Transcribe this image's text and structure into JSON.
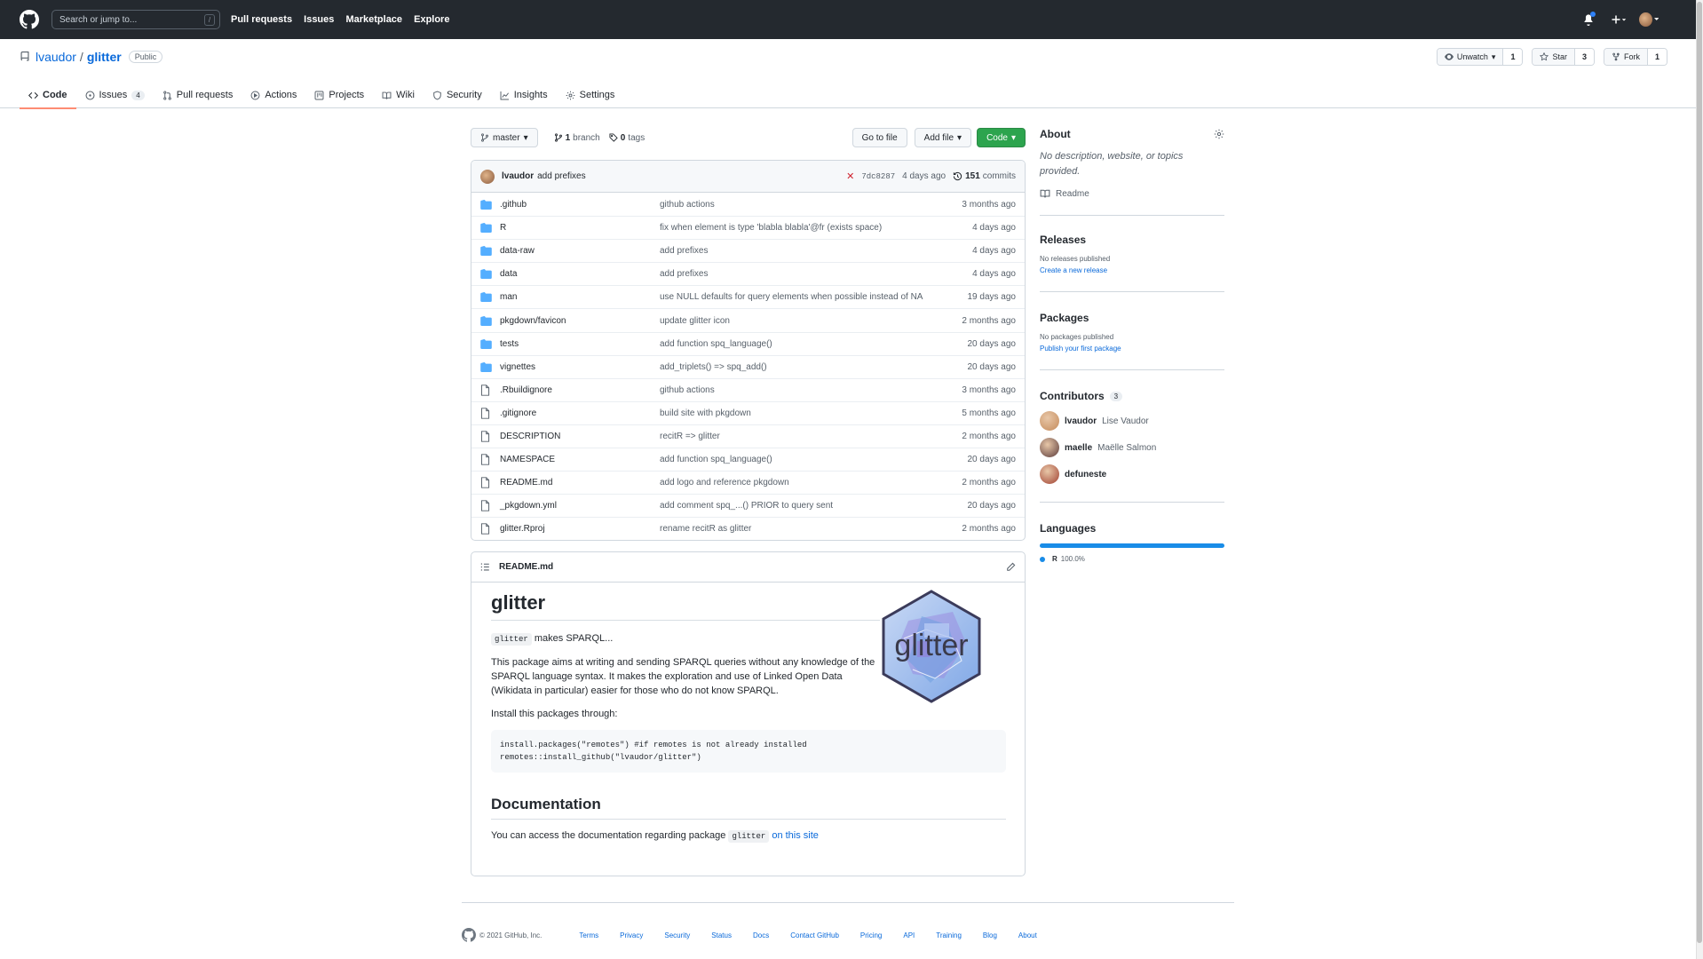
{
  "header": {
    "search_placeholder": "Search or jump to...",
    "search_key": "/",
    "nav": [
      "Pull requests",
      "Issues",
      "Marketplace",
      "Explore"
    ]
  },
  "repo": {
    "owner": "lvaudor",
    "name": "glitter",
    "visibility": "Public",
    "unwatch_label": "Unwatch",
    "watch_count": "1",
    "star_label": "Star",
    "star_count": "3",
    "fork_label": "Fork",
    "fork_count": "1"
  },
  "tabs": [
    {
      "label": "Code",
      "icon": "code-icon"
    },
    {
      "label": "Issues",
      "count": "4",
      "icon": "issue-icon"
    },
    {
      "label": "Pull requests",
      "icon": "pull-request-icon"
    },
    {
      "label": "Actions",
      "icon": "play-icon"
    },
    {
      "label": "Projects",
      "icon": "project-icon"
    },
    {
      "label": "Wiki",
      "icon": "book-icon"
    },
    {
      "label": "Security",
      "icon": "shield-icon"
    },
    {
      "label": "Insights",
      "icon": "graph-icon"
    },
    {
      "label": "Settings",
      "icon": "gear-icon"
    }
  ],
  "toolbar": {
    "branch": "master",
    "branches_count": "1",
    "branches_label": "branch",
    "tags_count": "0",
    "tags_label": "tags",
    "go_to_file": "Go to file",
    "add_file": "Add file",
    "code": "Code"
  },
  "commit": {
    "author": "lvaudor",
    "message": "add prefixes",
    "sha": "7dc8287",
    "age": "4 days ago",
    "commits_count": "151",
    "commits_label": "commits"
  },
  "files": [
    {
      "type": "dir",
      "name": ".github",
      "msg": "github actions",
      "age": "3 months ago"
    },
    {
      "type": "dir",
      "name": "R",
      "msg": "fix when element is type 'blabla blabla'@fr (exists space)",
      "age": "4 days ago"
    },
    {
      "type": "dir",
      "name": "data-raw",
      "msg": "add prefixes",
      "age": "4 days ago"
    },
    {
      "type": "dir",
      "name": "data",
      "msg": "add prefixes",
      "age": "4 days ago"
    },
    {
      "type": "dir",
      "name": "man",
      "msg": "use NULL defaults for query elements when possible instead of NA",
      "age": "19 days ago"
    },
    {
      "type": "dir",
      "name": "pkgdown/favicon",
      "msg": "update glitter icon",
      "age": "2 months ago"
    },
    {
      "type": "dir",
      "name": "tests",
      "msg": "add function spq_language()",
      "age": "20 days ago"
    },
    {
      "type": "dir",
      "name": "vignettes",
      "msg": "add_triplets() => spq_add()",
      "age": "20 days ago"
    },
    {
      "type": "file",
      "name": ".Rbuildignore",
      "msg": "github actions",
      "age": "3 months ago"
    },
    {
      "type": "file",
      "name": ".gitignore",
      "msg": "build site with pkgdown",
      "age": "5 months ago"
    },
    {
      "type": "file",
      "name": "DESCRIPTION",
      "msg": "recitR => glitter",
      "age": "2 months ago"
    },
    {
      "type": "file",
      "name": "NAMESPACE",
      "msg": "add function spq_language()",
      "age": "20 days ago"
    },
    {
      "type": "file",
      "name": "README.md",
      "msg": "add logo and reference pkgdown",
      "age": "2 months ago"
    },
    {
      "type": "file",
      "name": "_pkgdown.yml",
      "msg": "add comment spq_...() PRIOR to query sent",
      "age": "20 days ago"
    },
    {
      "type": "file",
      "name": "glitter.Rproj",
      "msg": "rename recitR as glitter",
      "age": "2 months ago"
    }
  ],
  "readme": {
    "filename": "README.md",
    "title": "glitter",
    "intro_code": "glitter",
    "intro_text": " makes SPARQL...",
    "para1": "This package aims at writing and sending SPARQL queries without any knowledge of the SPARQL language syntax. It makes the exploration and use of Linked Open Data (Wikidata in particular) easier for those who do not know SPARQL.",
    "install_text": "Install this packages through:",
    "code_line1": "install.packages(\"remotes\") #if remotes is not already installed",
    "code_line2": "remotes::install_github(\"lvaudor/glitter\")",
    "doc_heading": "Documentation",
    "doc_text": "You can access the documentation regarding package ",
    "doc_code": "glitter",
    "doc_link": "on this site",
    "logo_text": "glitter"
  },
  "sidebar": {
    "about_title": "About",
    "about_desc": "No description, website, or topics provided.",
    "readme_link": "Readme",
    "releases_title": "Releases",
    "releases_none": "No releases published",
    "releases_create": "Create a new release",
    "packages_title": "Packages",
    "packages_none": "No packages published",
    "packages_publish": "Publish your first package",
    "contributors_title": "Contributors",
    "contributors_count": "3",
    "contributors": [
      {
        "login": "lvaudor",
        "name": "Lise Vaudor",
        "color": "#c48a5a"
      },
      {
        "login": "maelle",
        "name": "Maëlle Salmon",
        "color": "#5a3a3a"
      },
      {
        "login": "defuneste",
        "name": "",
        "color": "#a04030"
      }
    ],
    "languages_title": "Languages",
    "languages": [
      {
        "name": "R",
        "percent": "100.0%",
        "color": "#198CE7"
      }
    ]
  },
  "footer": {
    "copyright": "© 2021 GitHub, Inc.",
    "links": [
      "Terms",
      "Privacy",
      "Security",
      "Status",
      "Docs",
      "Contact GitHub",
      "Pricing",
      "API",
      "Training",
      "Blog",
      "About"
    ]
  }
}
